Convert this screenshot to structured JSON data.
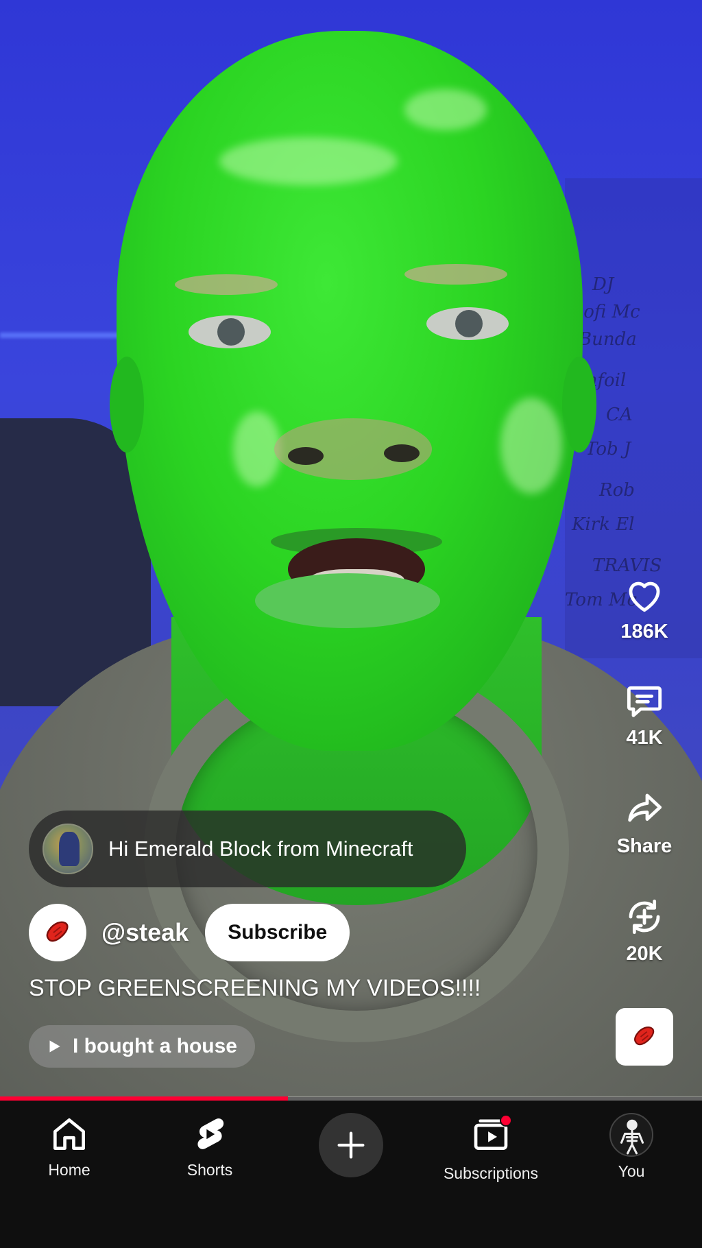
{
  "actions": {
    "like_count": "186K",
    "comment_count": "41K",
    "share_label": "Share",
    "remix_count": "20K",
    "like_icon": "heart-icon",
    "comment_icon": "comment-icon",
    "share_icon": "share-arrow-icon",
    "remix_icon": "remix-icon"
  },
  "pinned_comment": {
    "text": "Hi Emerald Block from Minecraft"
  },
  "channel": {
    "handle": "@steak",
    "subscribe_label": "Subscribe",
    "avatar_icon": "steak-icon"
  },
  "video": {
    "title": "STOP GREENSCREENING MY VIDEOS!!!!",
    "related_label": "I bought a house",
    "progress": 0.41
  },
  "nav": {
    "items": [
      {
        "label": "Home",
        "icon": "home-icon"
      },
      {
        "label": "Shorts",
        "icon": "shorts-icon"
      },
      {
        "label": "",
        "icon": "plus-icon"
      },
      {
        "label": "Subscriptions",
        "icon": "subscriptions-icon"
      },
      {
        "label": "You",
        "icon": "avatar"
      }
    ]
  },
  "colors": {
    "accent": "#ff0033",
    "nav_bg": "#0f0f0f",
    "subscribe_bg": "#ffffff"
  }
}
